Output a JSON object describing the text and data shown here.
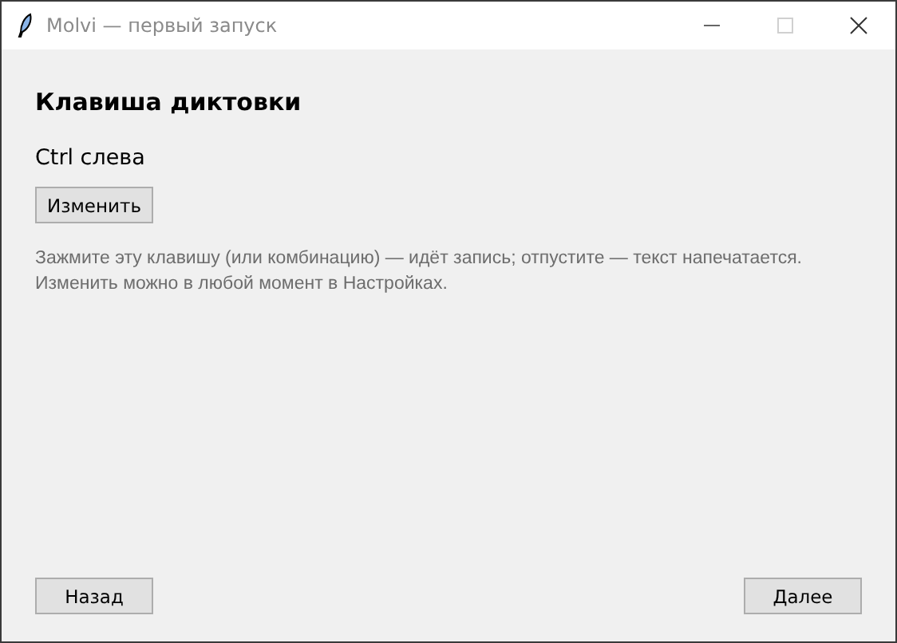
{
  "window": {
    "title": "Molvi — первый запуск",
    "maximize_disabled": true
  },
  "heading": "Клавиша диктовки",
  "current_key": "Ctrl слева",
  "change_button": "Изменить",
  "hint": [
    "Зажмите эту клавишу (или комбинацию) — идёт запись; отпустите — текст напечатается.",
    "Изменить можно в любой момент в Настройках."
  ],
  "footer": {
    "back": "Назад",
    "next": "Далее"
  }
}
